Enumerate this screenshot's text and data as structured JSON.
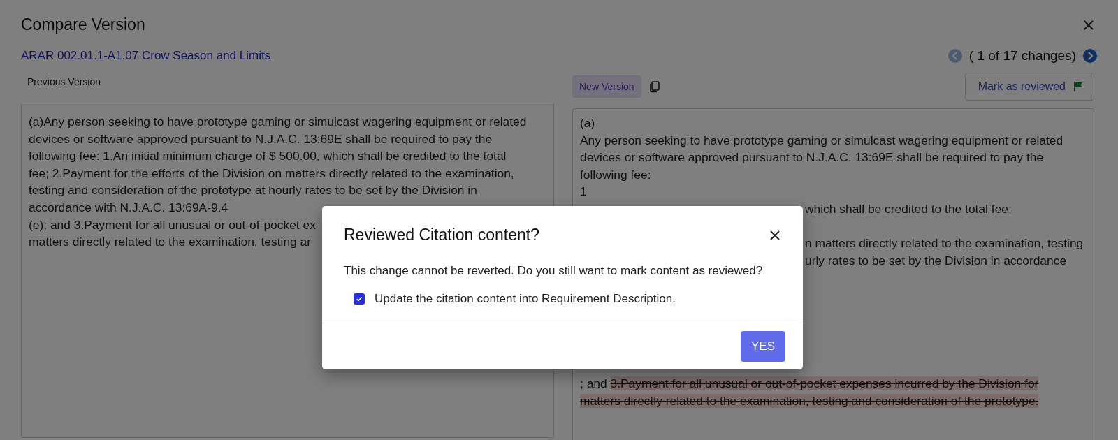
{
  "window": {
    "title": "Compare Version"
  },
  "citation": {
    "link": "ARAR 002.01.1-A1.07 Crow Season and Limits"
  },
  "navigation": {
    "status": "( 1 of 17 changes)",
    "previous_disabled": true,
    "next_disabled": false
  },
  "previous_version": {
    "label": "Previous Version",
    "lines": [
      {
        "text": "(a)Any person seeking to have prototype gaming or simulcast wagering equipment or related"
      },
      {
        "text": "devices or software approved pursuant to N.J.A.C. 13:69E shall be required to pay the"
      },
      {
        "text": "following fee: 1.An initial minimum charge of $ 500.00, which shall be credited to the total"
      },
      {
        "text": "fee; 2.Payment for the efforts of the Division on matters directly related to the examination,"
      },
      {
        "text": "testing and consideration of the prototype at hourly rates to be set by the Division in"
      },
      {
        "text": "accordance with N.J.A.C. 13:69A-9.4"
      },
      {
        "text": "(e); and 3.Payment for all unusual or out-of-pocket ex"
      },
      {
        "text": "matters directly related to the examination, testing ar"
      }
    ]
  },
  "new_version": {
    "label": "New Version",
    "mark_button": "Mark as reviewed",
    "lines": [
      {
        "text": "(a)",
        "kind": "full"
      },
      {
        "text": "Any person seeking to have prototype gaming or simulcast wagering equipment or related",
        "kind": "full"
      },
      {
        "text": "devices or software approved pursuant to N.J.A.C. 13:69E shall be required to pay the",
        "kind": "full"
      },
      {
        "text": "following fee:",
        "kind": "full"
      },
      {
        "text": "1",
        "kind": "full"
      },
      {
        "text": "which shall be credited to the total fee;",
        "kind": "tail"
      },
      {
        "text": "n matters directly related to the examination, testing",
        "kind": "tail"
      },
      {
        "text": "urly rates to be set by the Division in accordance",
        "kind": "tail"
      }
    ],
    "change": {
      "text": "; and ",
      "deleted": "3.Payment for all unusual or out-of-pocket expenses incurred by the Division for matters directly related to the examination, testing and consideration of the prototype."
    }
  },
  "dialog": {
    "title": "Reviewed Citation content?",
    "message": "This change cannot be reverted. Do you still want to mark content as reviewed?",
    "checkbox": {
      "label": "Update the citation content into Requirement Description.",
      "checked": true
    },
    "confirm_button": "YES"
  }
}
